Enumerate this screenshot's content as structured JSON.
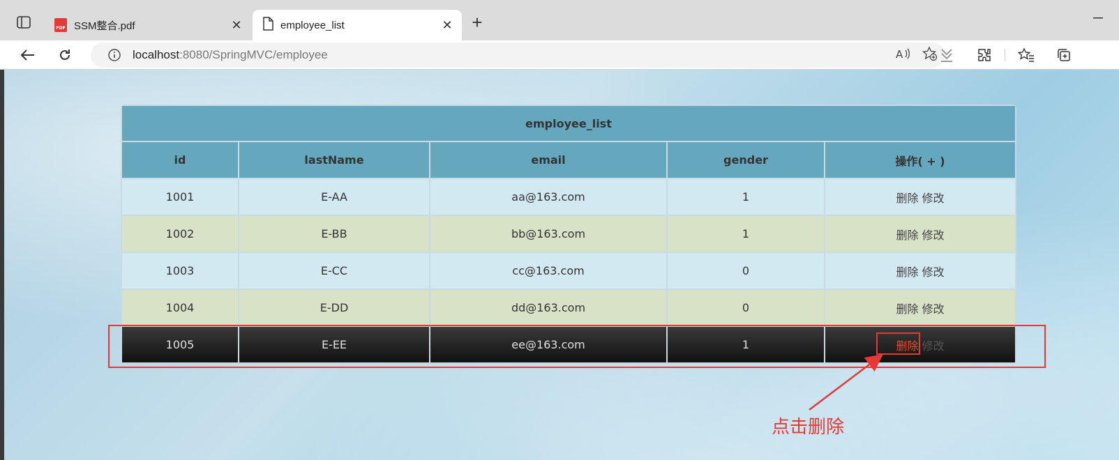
{
  "browser": {
    "tabs": [
      {
        "title": "SSM整合.pdf",
        "icon": "pdf-icon",
        "active": false
      },
      {
        "title": "employee_list",
        "icon": "page-icon",
        "active": true
      }
    ],
    "url_host": "localhost",
    "url_rest": ":8080/SpringMVC/employee"
  },
  "table": {
    "caption": "employee_list",
    "headers": [
      "id",
      "lastName",
      "email",
      "gender",
      "操作(  +  )"
    ],
    "rows": [
      {
        "id": "1001",
        "lastName": "E-AA",
        "email": "aa@163.com",
        "gender": "1",
        "delete": "删除",
        "edit": "修改"
      },
      {
        "id": "1002",
        "lastName": "E-BB",
        "email": "bb@163.com",
        "gender": "1",
        "delete": "删除",
        "edit": "修改"
      },
      {
        "id": "1003",
        "lastName": "E-CC",
        "email": "cc@163.com",
        "gender": "0",
        "delete": "删除",
        "edit": "修改"
      },
      {
        "id": "1004",
        "lastName": "E-DD",
        "email": "dd@163.com",
        "gender": "0",
        "delete": "删除",
        "edit": "修改"
      },
      {
        "id": "1005",
        "lastName": "E-EE",
        "email": "ee@163.com",
        "gender": "1",
        "delete": "删除",
        "edit": "修改"
      }
    ]
  },
  "annotation": {
    "label": "点击删除",
    "color": "#e53935"
  }
}
